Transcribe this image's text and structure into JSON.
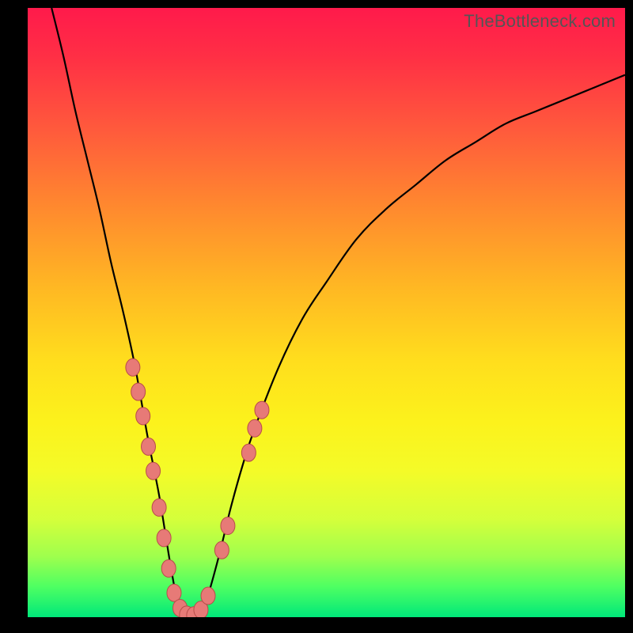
{
  "watermark": "TheBottleneck.com",
  "chart_data": {
    "type": "line",
    "title": "",
    "xlabel": "",
    "ylabel": "",
    "xlim": [
      0,
      100
    ],
    "ylim": [
      0,
      100
    ],
    "grid": false,
    "legend": false,
    "series": [
      {
        "name": "curve",
        "x": [
          4,
          6,
          8,
          10,
          12,
          14,
          16,
          18,
          20,
          21,
          22,
          23,
          24,
          25,
          26,
          27,
          28,
          29,
          30,
          32,
          34,
          36,
          38,
          42,
          46,
          50,
          55,
          60,
          65,
          70,
          75,
          80,
          85,
          90,
          95,
          100
        ],
        "values": [
          100,
          92,
          83,
          75,
          67,
          58,
          50,
          41,
          30,
          25,
          20,
          14,
          8,
          3,
          1,
          0,
          0,
          1,
          3,
          10,
          18,
          25,
          31,
          41,
          49,
          55,
          62,
          67,
          71,
          75,
          78,
          81,
          83,
          85,
          87,
          89
        ]
      }
    ],
    "markers": [
      {
        "x": 17.6,
        "y": 41
      },
      {
        "x": 18.5,
        "y": 37
      },
      {
        "x": 19.3,
        "y": 33
      },
      {
        "x": 20.2,
        "y": 28
      },
      {
        "x": 21.0,
        "y": 24
      },
      {
        "x": 22.0,
        "y": 18
      },
      {
        "x": 22.8,
        "y": 13
      },
      {
        "x": 23.6,
        "y": 8
      },
      {
        "x": 24.5,
        "y": 4
      },
      {
        "x": 25.5,
        "y": 1.5
      },
      {
        "x": 26.6,
        "y": 0.4
      },
      {
        "x": 27.8,
        "y": 0.3
      },
      {
        "x": 29.0,
        "y": 1.2
      },
      {
        "x": 30.2,
        "y": 3.5
      },
      {
        "x": 32.5,
        "y": 11
      },
      {
        "x": 33.5,
        "y": 15
      },
      {
        "x": 37.0,
        "y": 27
      },
      {
        "x": 38.0,
        "y": 31
      },
      {
        "x": 39.2,
        "y": 34
      }
    ],
    "marker_style": {
      "fill": "#e77a77",
      "stroke": "#b84d4a",
      "rx": 9,
      "ry": 11
    }
  }
}
